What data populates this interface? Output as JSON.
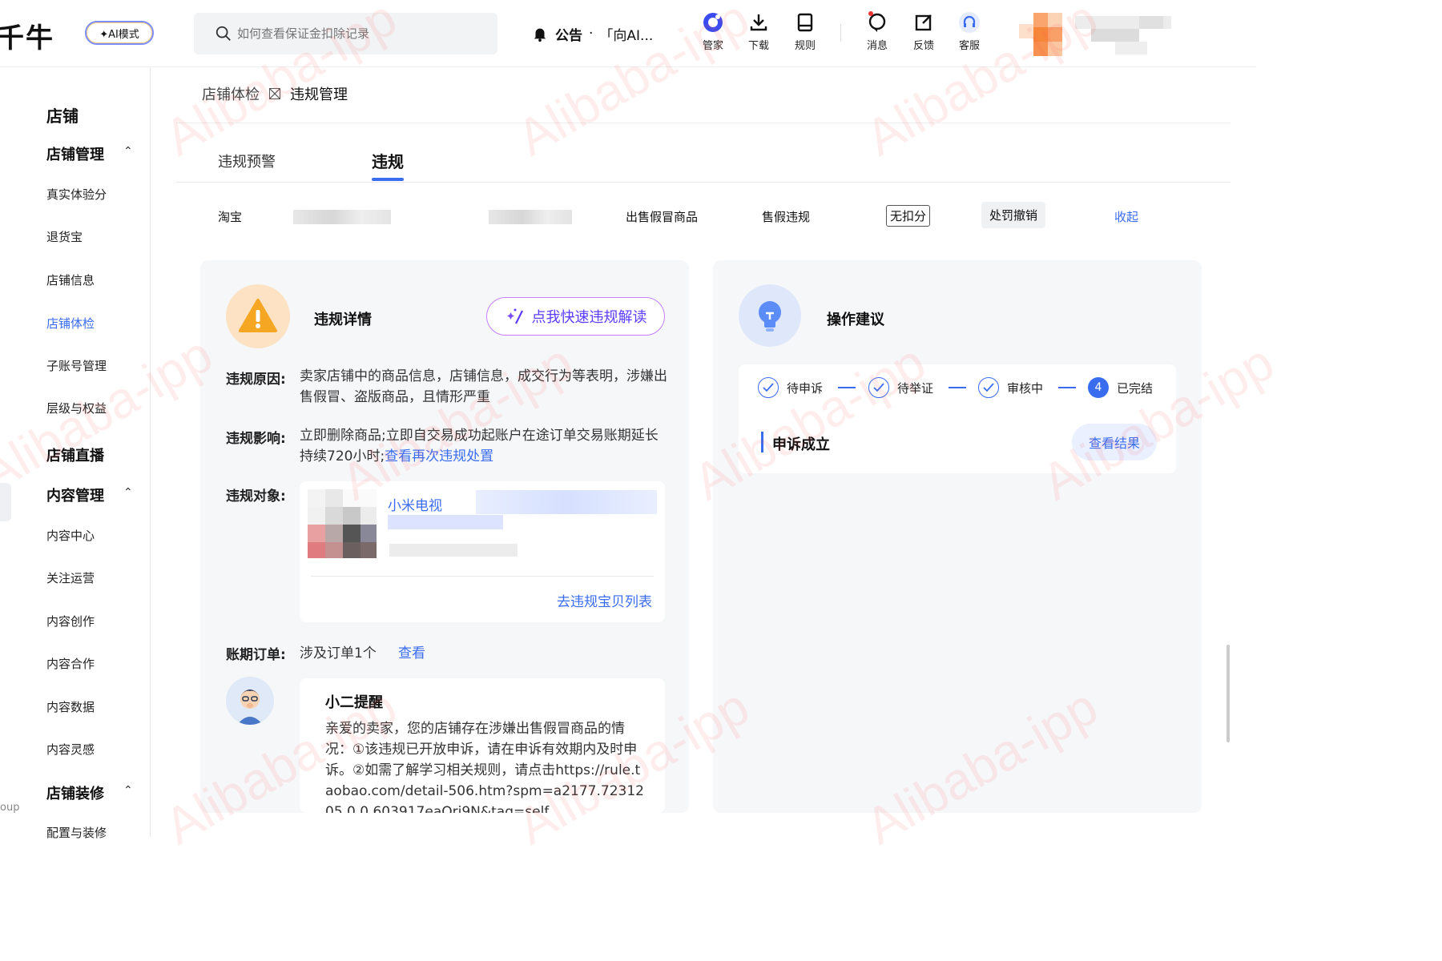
{
  "header": {
    "logo": "千牛",
    "ai_mode": "✦AI模式",
    "search_placeholder": "如何查看保证金扣除记录",
    "notice_label": "公告",
    "notice_dot": "·",
    "notice_text": "「向AI...",
    "tools": [
      {
        "label": "管家",
        "icon": "assistant-icon"
      },
      {
        "label": "下载",
        "icon": "download-icon"
      },
      {
        "label": "规则",
        "icon": "rules-icon"
      },
      {
        "label": "消息",
        "icon": "message-icon"
      },
      {
        "label": "反馈",
        "icon": "feedback-icon"
      },
      {
        "label": "客服",
        "icon": "service-icon"
      }
    ]
  },
  "sidebar": {
    "section_title": "店铺",
    "groups": [
      {
        "title": "店铺管理",
        "items": [
          "真实体验分",
          "退货宝",
          "店铺信息",
          "店铺体检",
          "子账号管理",
          "层级与权益"
        ]
      },
      {
        "title": "店铺直播",
        "items": []
      },
      {
        "title": "内容管理",
        "items": [
          "内容中心",
          "关注运营",
          "内容创作",
          "内容合作",
          "内容数据",
          "内容灵感"
        ]
      },
      {
        "title": "店铺装修",
        "items": [
          "配置与装修"
        ]
      }
    ],
    "active_item": "店铺体检",
    "bottom_text": "oup"
  },
  "breadcrumb": {
    "parent": "店铺体检",
    "current": "违规管理"
  },
  "tabs": [
    {
      "label": "违规预警",
      "selected": false
    },
    {
      "label": "违规",
      "selected": true
    }
  ],
  "info_row": {
    "platform": "淘宝",
    "violation_type": "出售假冒商品",
    "category": "售假违规",
    "deduct_tag": "无扣分",
    "status_tag": "处罚撤销",
    "collapse": "收起"
  },
  "detail": {
    "title": "违规详情",
    "ai_button": "点我快速违规解读",
    "reason_label": "违规原因:",
    "reason_text": "卖家店铺中的商品信息，店铺信息，成交行为等表明，涉嫌出售假冒、盗版商品，且情形严重",
    "impact_label": "违规影响:",
    "impact_text": "立即删除商品;立即自交易成功起账户在途订单交易账期延长持续720小时;",
    "impact_link": "查看再次违规处置",
    "object_label": "违规对象:",
    "object_name": "小米电视",
    "object_link": "去违规宝贝列表",
    "order_label": "账期订单:",
    "order_text": "涉及订单1个",
    "order_link": "查看",
    "tip_title": "小二提醒",
    "tip_text": "亲爱的卖家，您的店铺存在涉嫌出售假冒商品的情况：①该违规已开放申诉，请在申诉有效期内及时申诉。②如需了解学习相关规则，请点击https://rule.taobao.com/detail-506.htm?spm=a2177.7231205.0.0.603917eaOri9N&tag=self"
  },
  "suggestion": {
    "title": "操作建议",
    "steps": [
      {
        "label": "待申诉",
        "state": "done"
      },
      {
        "label": "待举证",
        "state": "done"
      },
      {
        "label": "审核中",
        "state": "done"
      },
      {
        "label": "已完结",
        "state": "current",
        "number": "4"
      }
    ],
    "result_text": "申诉成立",
    "result_button": "查看结果"
  },
  "watermark": "Alibaba-ipp",
  "colors": {
    "accent": "#3a6cf0",
    "warning": "#f5a623",
    "ai_purple": "#5a3dff"
  }
}
